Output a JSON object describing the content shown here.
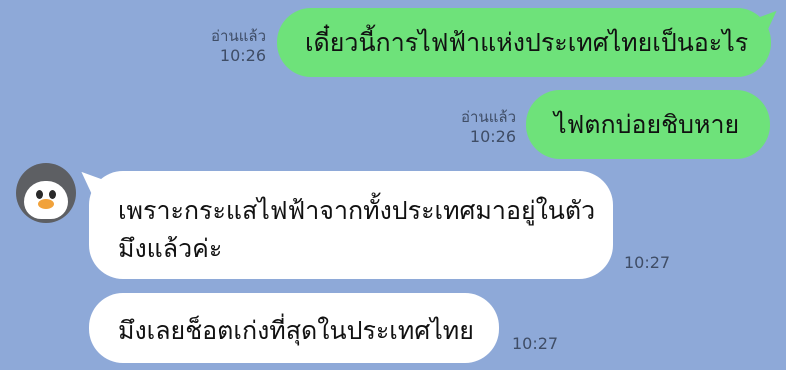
{
  "messages": {
    "sent": [
      {
        "text": "เดี๋ยวนี้การไฟฟ้าแห่งประเทศไทยเป็นอะไร",
        "read_label": "อ่านแล้ว",
        "time": "10:26"
      },
      {
        "text": "ไฟตกบ่อยชิบหาย",
        "read_label": "อ่านแล้ว",
        "time": "10:26"
      }
    ],
    "received": [
      {
        "line1": "เพราะกระแสไฟฟ้าจากทั้งประเทศมาอยู่ในตัว",
        "line2": "มึงแล้วค่ะ",
        "time": "10:27"
      },
      {
        "text": "มึงเลยช็อตเก่งที่สุดในประเทศไทย",
        "time": "10:27"
      }
    ]
  },
  "avatar": {
    "icon": "penguin-icon"
  },
  "colors": {
    "background": "#8ea9d8",
    "sent_bubble": "#6ee27a",
    "received_bubble": "#ffffff",
    "meta_text": "#3f4d66"
  }
}
